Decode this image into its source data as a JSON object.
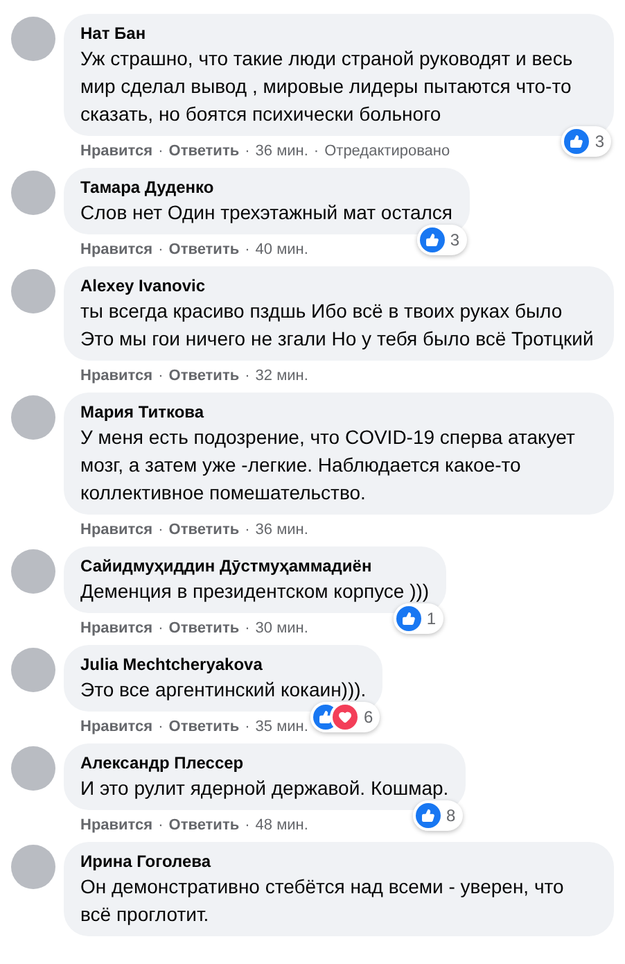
{
  "comments": [
    {
      "author": "Нат Бан",
      "text": "Уж страшно, что такие люди страной руководят и весь мир сделал вывод , мировые лидеры пытаются что-то сказать, но боятся психически больного",
      "meta": [
        {
          "kind": "link",
          "text": "Нравится"
        },
        {
          "kind": "sep",
          "text": "·"
        },
        {
          "kind": "link",
          "text": "Ответить"
        },
        {
          "kind": "sep",
          "text": "·"
        },
        {
          "kind": "time",
          "text": "36 мин."
        },
        {
          "kind": "sep",
          "text": "·"
        },
        {
          "kind": "note",
          "text": "Отредактировано"
        }
      ],
      "reactions": [
        {
          "kind": "like"
        }
      ],
      "reaction_count": "3"
    },
    {
      "author": "Тамара Дуденко",
      "text": "Слов нет Один трехэтажный мат остался",
      "meta": [
        {
          "kind": "link",
          "text": "Нравится"
        },
        {
          "kind": "sep",
          "text": "·"
        },
        {
          "kind": "link",
          "text": "Ответить"
        },
        {
          "kind": "sep",
          "text": "·"
        },
        {
          "kind": "time",
          "text": "40 мин."
        }
      ],
      "reactions": [
        {
          "kind": "like"
        }
      ],
      "reaction_count": "3"
    },
    {
      "author": "Alexey Ivanovic",
      "text": "ты всегда красиво пздшь Ибо всё в твоих руках было Это мы гои ничего не згали Но у тебя было всё Тротцкий",
      "meta": [
        {
          "kind": "link",
          "text": "Нравится"
        },
        {
          "kind": "sep",
          "text": "·"
        },
        {
          "kind": "link",
          "text": "Ответить"
        },
        {
          "kind": "sep",
          "text": "·"
        },
        {
          "kind": "time",
          "text": "32 мин."
        }
      ]
    },
    {
      "author": "Мария Титкова",
      "text": "У меня есть подозрение, что COVID-19 сперва атакует мозг, а затем уже -легкие. Наблюдается какое-то коллективное помешательство.",
      "meta": [
        {
          "kind": "link",
          "text": "Нравится"
        },
        {
          "kind": "sep",
          "text": "·"
        },
        {
          "kind": "link",
          "text": "Ответить"
        },
        {
          "kind": "sep",
          "text": "·"
        },
        {
          "kind": "time",
          "text": "36 мин."
        }
      ]
    },
    {
      "author": "Сайидмуҳиддин Дӯстмуҳаммадиён",
      "text": "Деменция в президентском корпусе )))",
      "meta": [
        {
          "kind": "link",
          "text": "Нравится"
        },
        {
          "kind": "sep",
          "text": "·"
        },
        {
          "kind": "link",
          "text": "Ответить"
        },
        {
          "kind": "sep",
          "text": "·"
        },
        {
          "kind": "time",
          "text": "30 мин."
        }
      ],
      "reactions": [
        {
          "kind": "like"
        }
      ],
      "reaction_count": "1"
    },
    {
      "author": "Julia Mechtcheryakova",
      "text": "Это все аргентинский кокаин))).",
      "meta": [
        {
          "kind": "link",
          "text": "Нравится"
        },
        {
          "kind": "sep",
          "text": "·"
        },
        {
          "kind": "link",
          "text": "Ответить"
        },
        {
          "kind": "sep",
          "text": "·"
        },
        {
          "kind": "time",
          "text": "35 мин."
        }
      ],
      "reactions": [
        {
          "kind": "like"
        },
        {
          "kind": "love"
        }
      ],
      "reaction_count": "6"
    },
    {
      "author": "Александр Плессер",
      "text": "И это рулит ядерной державой. Кошмар.",
      "meta": [
        {
          "kind": "link",
          "text": "Нравится"
        },
        {
          "kind": "sep",
          "text": "·"
        },
        {
          "kind": "link",
          "text": "Ответить"
        },
        {
          "kind": "sep",
          "text": "·"
        },
        {
          "kind": "time",
          "text": "48 мин."
        }
      ],
      "reactions": [
        {
          "kind": "like"
        }
      ],
      "reaction_count": "8"
    },
    {
      "author": "Ирина Гоголева",
      "text": "Он демонстративно стебётся над всеми - уверен, что всё проглотит."
    }
  ]
}
